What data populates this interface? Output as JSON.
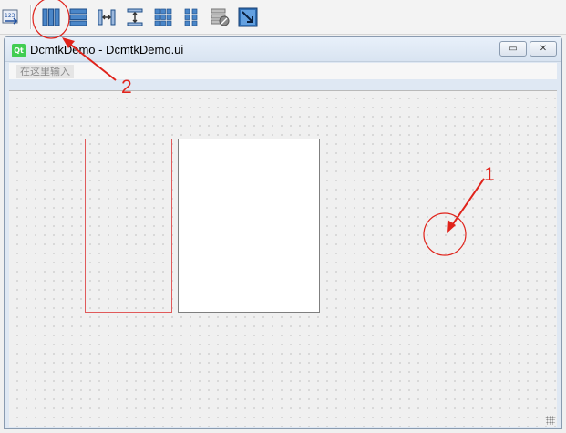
{
  "toolbar": {
    "buttons": [
      {
        "name": "edit-tab-order",
        "icon": "tab-order-icon"
      },
      {
        "name": "layout-horizontal",
        "icon": "layout-horizontal-icon"
      },
      {
        "name": "layout-vertical",
        "icon": "layout-vertical-icon"
      },
      {
        "name": "layout-h-splitter",
        "icon": "splitter-horizontal-icon"
      },
      {
        "name": "layout-v-splitter",
        "icon": "splitter-vertical-icon"
      },
      {
        "name": "layout-grid",
        "icon": "grid-layout-icon"
      },
      {
        "name": "layout-form",
        "icon": "form-layout-icon"
      },
      {
        "name": "break-layout",
        "icon": "break-layout-icon"
      },
      {
        "name": "adjust-size",
        "icon": "adjust-size-icon"
      }
    ]
  },
  "window": {
    "logo_text": "Qt",
    "title": "DcmtkDemo - DcmtkDemo.ui",
    "minimize_glyph": "▭",
    "close_glyph": "✕"
  },
  "menubar": {
    "input_placeholder": "在这里输入"
  },
  "annotations": {
    "label_1": "1",
    "label_2": "2"
  },
  "colors": {
    "annotation_red": "#e0231b",
    "layout_blue": "#2f6fb3"
  }
}
